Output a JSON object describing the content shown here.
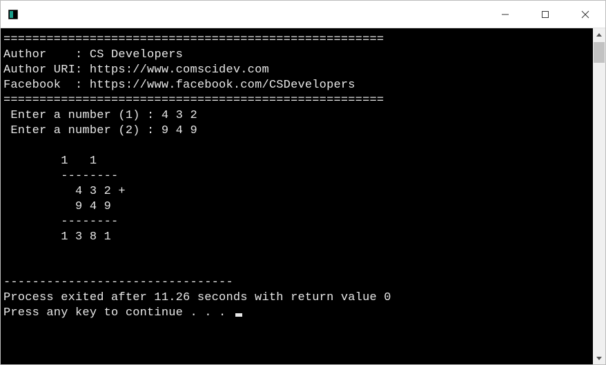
{
  "window": {
    "title": ""
  },
  "console": {
    "divider": "=====================================================",
    "author_label": "Author    : ",
    "author_value": "CS Developers",
    "author_uri_label": "Author URI: ",
    "author_uri_value": "https://www.comscidev.com",
    "facebook_label": "Facebook  : ",
    "facebook_value": "https://www.facebook.com/CSDevelopers",
    "prompt1": " Enter a number (1) : ",
    "input1": "4 3 2",
    "prompt2": " Enter a number (2) : ",
    "input2": "9 4 9",
    "carry_row": "        1   1",
    "dash_row1": "        --------",
    "operand1_row": "          4 3 2 +",
    "operand2_row": "          9 4 9",
    "dash_row2": "        --------",
    "result_row": "        1 3 8 1",
    "exit_dashes": "--------------------------------",
    "exit_line": "Process exited after 11.26 seconds with return value 0",
    "press_key": "Press any key to continue . . . "
  }
}
